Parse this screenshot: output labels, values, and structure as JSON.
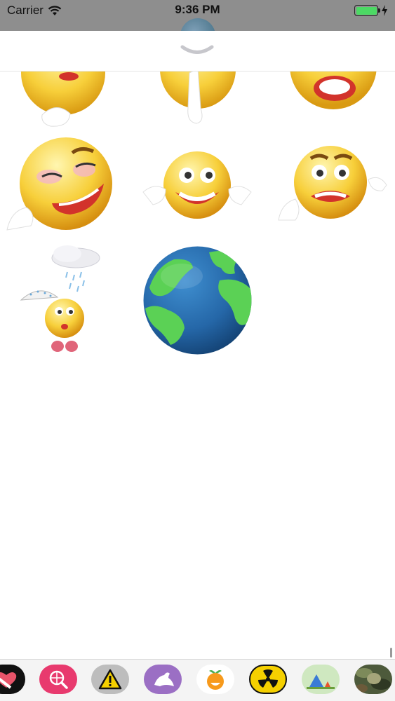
{
  "status_bar": {
    "carrier": "Carrier",
    "time": "9:36 PM",
    "battery_color": "#4cd964"
  },
  "sheet": {
    "collapse_icon": "chevron-down-icon"
  },
  "stickers": [
    {
      "name": "emoji-kiss-partial"
    },
    {
      "name": "emoji-shush-partial"
    },
    {
      "name": "emoji-shout-partial"
    },
    {
      "name": "emoji-smirk"
    },
    {
      "name": "emoji-grin-cheeks"
    },
    {
      "name": "emoji-grimace"
    },
    {
      "name": "emoji-rain-umbrella"
    },
    {
      "name": "earth-globe"
    }
  ],
  "app_drawer": {
    "apps": [
      {
        "name": "heart-sticker-app",
        "color": "#111111"
      },
      {
        "name": "globe-search-app",
        "color": "#e83a6e"
      },
      {
        "name": "warning-sign-app",
        "color": "#bdbdbd"
      },
      {
        "name": "pigeon-app",
        "color": "#9b6fc4"
      },
      {
        "name": "orange-emoji-app",
        "color": "#ffffff"
      },
      {
        "name": "radiation-app",
        "color": "#f5d000"
      },
      {
        "name": "camping-app",
        "color": "#cfe8c0"
      },
      {
        "name": "camouflage-app",
        "color": "#4d5a3b"
      }
    ]
  }
}
